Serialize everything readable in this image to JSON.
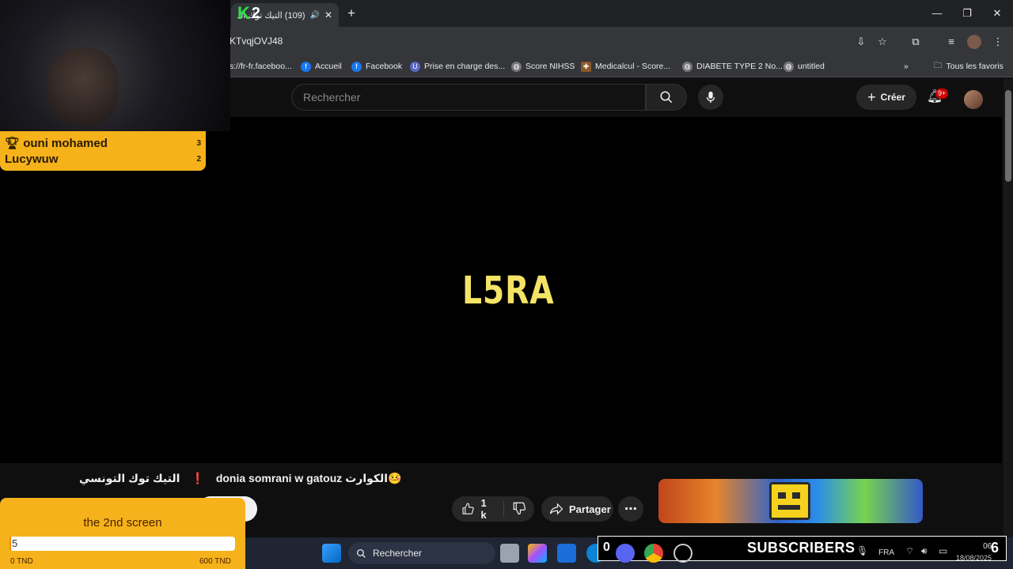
{
  "browser": {
    "tab_title": "(109) التيك توك التونسي",
    "address": "KTvqjOVJ48",
    "bookmarks": [
      {
        "label": "s://fr-fr.faceboo..."
      },
      {
        "label": "Accueil"
      },
      {
        "label": "Facebook"
      },
      {
        "label": "Prise en charge des..."
      },
      {
        "label": "Score NIHSS"
      },
      {
        "label": "Medicalcul - Score..."
      },
      {
        "label": "DIABETE TYPE 2 No..."
      },
      {
        "label": "untitled"
      }
    ],
    "all_favorites": "Tous les favoris"
  },
  "youtube": {
    "search_placeholder": "Rechercher",
    "create_label": "Créer",
    "notification_count": "9+",
    "video_title_overlay": "L5RA",
    "channel_tag": "التيك توك التونسي",
    "separator": "❗",
    "video_title": "donia somrani w gatouz الكوارث🤒",
    "like_count": "1 k",
    "share_label": "Partager"
  },
  "stream_overlay": {
    "kick_count": "2",
    "leaderboard": [
      {
        "name": "ouni mohamed",
        "rank": "3"
      },
      {
        "name": "Lucywuw",
        "rank": "2"
      }
    ],
    "goal_title": "the 2nd screen",
    "goal_value": "5",
    "goal_progress": 0.008,
    "goal_min": "0 TND",
    "goal_max": "600 TND",
    "subscribers_label": "SUBSCRIBERS",
    "subscribers_count": "0",
    "subscribers_right": "6"
  },
  "taskbar": {
    "search_label": "Rechercher",
    "language": "FRA",
    "time": "06:",
    "date": "18/08/2025"
  },
  "colors": {
    "overlay_yellow": "#f5b21a",
    "title_yellow": "#f4e466",
    "kick_green": "#2ce04b",
    "badge_red": "#cc0000"
  }
}
